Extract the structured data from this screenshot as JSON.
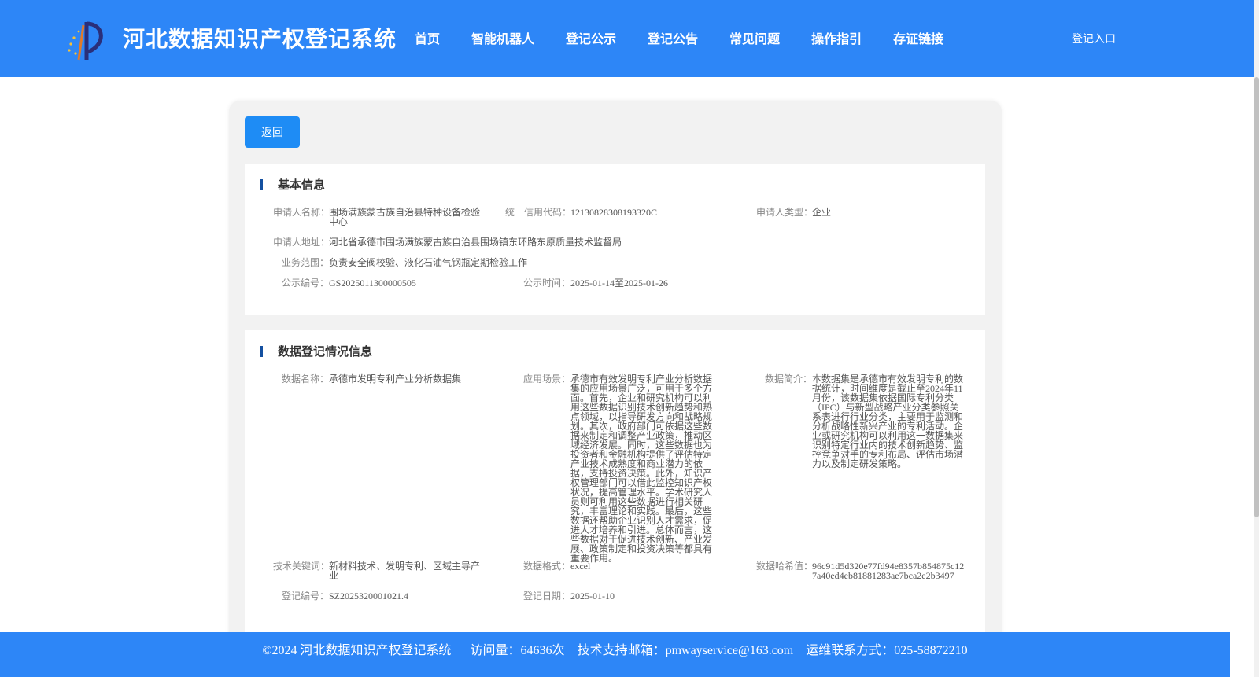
{
  "header": {
    "site_title": "河北数据知识产权登记系统",
    "nav": [
      "首页",
      "智能机器人",
      "登记公示",
      "登记公告",
      "常见问题",
      "操作指引",
      "存证链接"
    ],
    "login_label": "登记入口",
    "bg_color": "#2d86f7",
    "logo_icon": "logo-icon"
  },
  "back_label": "返回",
  "basic": {
    "title": "基本信息",
    "applicant_name_label": "申请人名称：",
    "applicant_name": "围场满族蒙古族自治县特种设备检验中心",
    "credit_code_label": "统一信用代码：",
    "credit_code": "12130828308193320C",
    "applicant_type_label": "申请人类型：",
    "applicant_type": "企业",
    "address_label": "申请人地址：",
    "address": "河北省承德市围场满族蒙古族自治县围场镇东环路东原质量技术监督局",
    "scope_label": "业务范围：",
    "scope": "负责安全阀校验、液化石油气钢瓶定期检验工作",
    "pub_no_label": "公示编号：",
    "pub_no": "GS2025011300000505",
    "pub_time_label": "公示时间：",
    "pub_time": "2025-01-14至2025-01-26"
  },
  "data_info": {
    "title": "数据登记情况信息",
    "name_label": "数据名称：",
    "name": "承德市发明专利产业分析数据集",
    "scene_label": "应用场景：",
    "scene": "承德市有效发明专利产业分析数据集的应用场景广泛，可用于多个方面。首先，企业和研究机构可以利用这些数据识别技术创新趋势和热点领域，以指导研发方向和战略规划。其次，政府部门可依据这些数据来制定和调整产业政策，推动区域经济发展。同时，这些数据也为投资者和金融机构提供了评估特定产业技术成熟度和商业潜力的依据，支持投资决策。此外，知识产权管理部门可以借此监控知识产权状况，提高管理水平。学术研究人员则可利用这些数据进行相关研究，丰富理论和实践。最后，这些数据还帮助企业识别人才需求，促进人才培养和引进。总体而言，这些数据对于促进技术创新、产业发展、政策制定和投资决策等都具有重要作用。",
    "intro_label": "数据简介：",
    "intro": "本数据集是承德市有效发明专利的数据统计，时间维度是截止至2024年11月份，该数据集依据国际专利分类（IPC）与新型战略产业分类参照关系表进行行业分类，主要用于监测和分析战略性新兴产业的专利活动。企业或研究机构可以利用这一数据集来识别特定行业内的技术创新趋势、监控竞争对手的专利布局、评估市场潜力以及制定研发策略。",
    "keywords_label": "技术关键词：",
    "keywords": "新材料技术、发明专利、区域主导产业",
    "format_label": "数据格式：",
    "format": "excel",
    "hash_label": "数据哈希值：",
    "hash": "96c91d5d320e77fd94e8357b854875c127a40ed4eb81881283ae7bca2e2b3497",
    "reg_no_label": "登记编号：",
    "reg_no": "SZ2025320001021.4",
    "reg_date_label": "登记日期：",
    "reg_date": "2025-01-10"
  },
  "footer": {
    "copyright": "©2024 河北数据知识产权登记系统",
    "visits": "访问量：64636次",
    "email": "技术支持邮箱：pmwayservice@163.com",
    "phone": "运维联系方式：025-58872210"
  }
}
